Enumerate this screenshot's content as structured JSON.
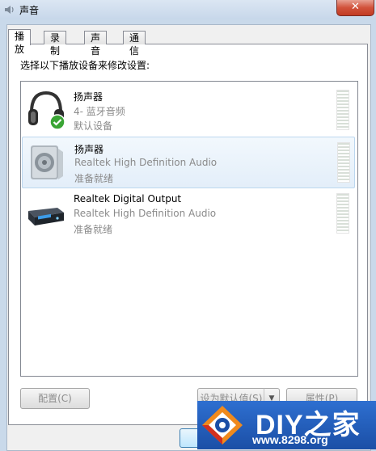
{
  "window": {
    "title": "声音",
    "close_label": "✕"
  },
  "tabs": [
    {
      "label": "播放",
      "active": true
    },
    {
      "label": "录制",
      "active": false
    },
    {
      "label": "声音",
      "active": false
    },
    {
      "label": "通信",
      "active": false
    }
  ],
  "instruction": "选择以下播放设备来修改设置:",
  "devices": [
    {
      "name": "扬声器",
      "description": "4- 蓝牙音频",
      "status": "默认设备",
      "icon": "headphones-icon",
      "default": true
    },
    {
      "name": "扬声器",
      "description": "Realtek High Definition Audio",
      "status": "准备就绪",
      "icon": "speaker-icon",
      "selected": true
    },
    {
      "name": "Realtek Digital Output",
      "description": "Realtek High Definition Audio",
      "status": "准备就绪",
      "icon": "digital-output-icon"
    }
  ],
  "buttons": {
    "configure": "配置(C)",
    "set_default": "设为默认值(S)",
    "properties": "属性(P)"
  },
  "watermark": {
    "title": "DIY之家",
    "url": "www.8298.org"
  },
  "colors": {
    "accent": "#1b4fa6",
    "selection": "#e3eef9",
    "close": "#c13a23"
  }
}
